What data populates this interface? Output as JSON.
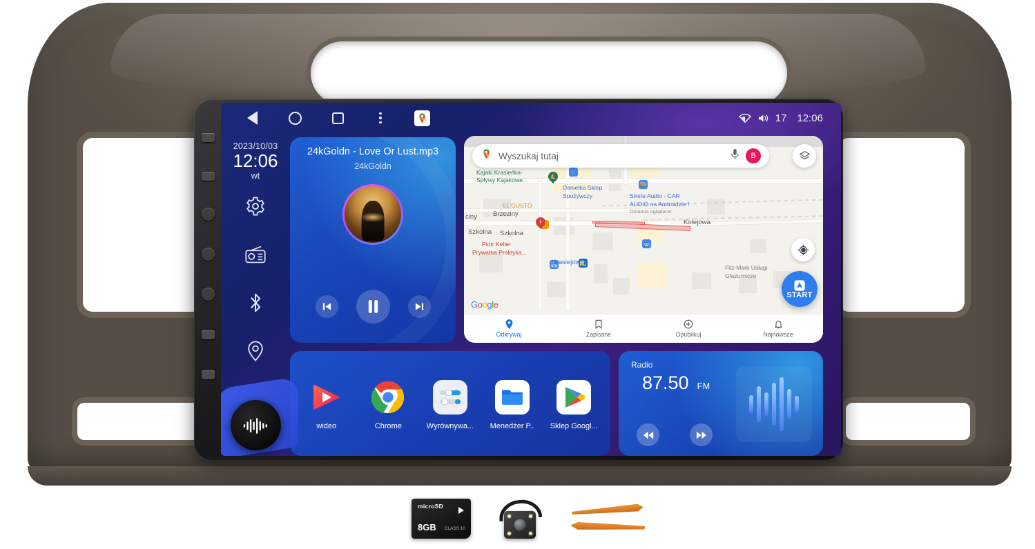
{
  "status_bar": {
    "wifi_icon": "wifi-icon",
    "volume_icon": "volume-icon",
    "volume_level": "17",
    "time": "12:06"
  },
  "nav_bar": {
    "back": "back-triangle-icon",
    "home": "home-circle-icon",
    "recents": "recents-square-icon",
    "menu": "overflow-menu-icon",
    "maps_shortcut": "google-maps-icon"
  },
  "sidebar": {
    "date": "2023/10/03",
    "time": "12:06",
    "weekday": "wt",
    "items": [
      {
        "name": "settings",
        "icon": "gear-icon"
      },
      {
        "name": "radio",
        "icon": "radio-icon"
      },
      {
        "name": "bluetooth",
        "icon": "bluetooth-icon"
      },
      {
        "name": "navigation",
        "icon": "location-pin-icon"
      }
    ],
    "assistant": {
      "label": "voice-assistant",
      "icon": "waveform-icon"
    }
  },
  "music_widget": {
    "title": "24kGoldn - Love Or Lust.mp3",
    "artist": "24kGoldn",
    "controls": {
      "previous": "previous-track-icon",
      "play_pause": "pause-icon",
      "next": "next-track-icon"
    }
  },
  "map_widget": {
    "search": {
      "placeholder": "Wyszukaj tutaj",
      "value": "",
      "logo": "google-maps-pin-icon",
      "mic": "microphone-icon",
      "avatar_initial": "B"
    },
    "layers_button": "layers-icon",
    "locate_button": "my-location-icon",
    "start_button": {
      "label": "START",
      "icon": "navigation-arrow-icon"
    },
    "attribution": "Google",
    "places": [
      {
        "text": "Kajaki Krasieńka-",
        "color": "green"
      },
      {
        "text": "Spływy Kajakowe...",
        "color": "green"
      },
      {
        "text": "Danielka Sklep",
        "color": "blue"
      },
      {
        "text": "Spożywczy",
        "color": "blue"
      },
      {
        "text": "Strefa Audio - CAR",
        "color": "blue"
      },
      {
        "text": "AUDIO na Androidzie !",
        "color": "blue"
      },
      {
        "text": "Ostatnio oglądane",
        "color": "sub"
      },
      {
        "text": "EL'GUSTO",
        "color": "orange"
      },
      {
        "text": "Piotr Keller",
        "color": "red"
      },
      {
        "text": "Prywatna Praktyka...",
        "color": "red"
      },
      {
        "text": "Fliz-Mark Usługi",
        "color": "gray"
      },
      {
        "text": "Glazurnicze",
        "color": "gray"
      }
    ],
    "streets": [
      {
        "text": "ciny"
      },
      {
        "text": "Brzeziny"
      },
      {
        "text": "Szkolna"
      },
      {
        "text": "Szkolna"
      },
      {
        "text": "Kolejowa"
      },
      {
        "text": "Krasiejów"
      }
    ],
    "tabs": [
      {
        "label": "Odkrywaj",
        "icon": "explore-pin-icon",
        "active": true
      },
      {
        "label": "Zapisane",
        "icon": "bookmark-icon",
        "active": false
      },
      {
        "label": "Opublikuj",
        "icon": "contribute-plus-icon",
        "active": false
      },
      {
        "label": "Najnowsze",
        "icon": "bell-icon",
        "active": false
      }
    ]
  },
  "app_dock": {
    "apps": [
      {
        "label": "wideo",
        "icon": "video-player-icon"
      },
      {
        "label": "Chrome",
        "icon": "chrome-icon"
      },
      {
        "label": "Wyrównywa...",
        "icon": "equalizer-icon"
      },
      {
        "label": "Menedżer P..",
        "icon": "file-manager-icon"
      },
      {
        "label": "Sklep Googl...",
        "icon": "google-play-icon"
      }
    ]
  },
  "radio_widget": {
    "label": "Radio",
    "frequency": "87.50",
    "band": "FM",
    "controls": {
      "previous": "rewind-icon",
      "next": "fast-forward-icon"
    },
    "visualizer": "audio-waveform-icon"
  },
  "accessories": [
    {
      "name": "microsd-card",
      "capacity": "8GB",
      "brand": "microSD",
      "class": "CLASS 10"
    },
    {
      "name": "backup-camera"
    },
    {
      "name": "pry-tools"
    }
  ],
  "colors": {
    "screen_blue": "#1a48bb",
    "accent_cyan": "#3cc8ff",
    "maps_blue": "#1a73e8",
    "start_blue": "#2f7ef0",
    "avatar_pink": "#e8175d",
    "pry_orange": "#f0953a"
  }
}
